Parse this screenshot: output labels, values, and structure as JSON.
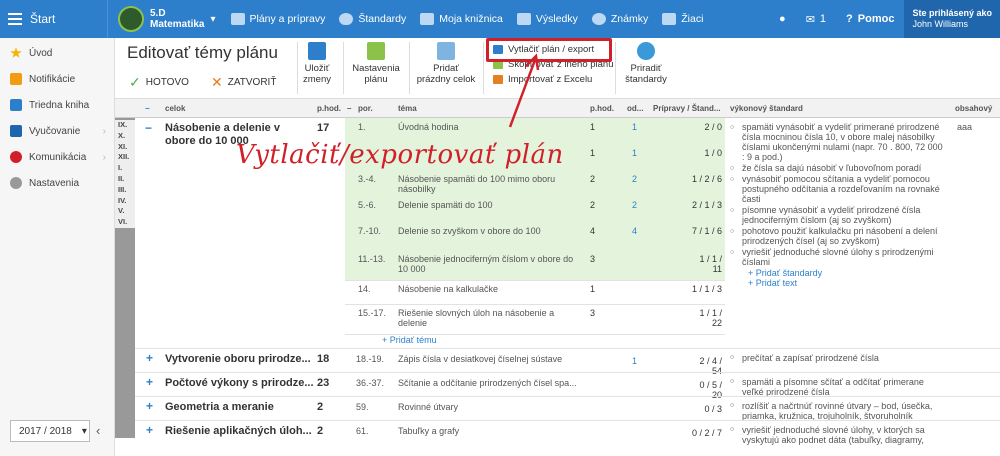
{
  "topbar": {
    "start": "Štart",
    "class_name": "5.D",
    "subject": "Matematika",
    "nav": [
      "Plány a prípravy",
      "Štandardy",
      "Moja knižnica",
      "Výsledky",
      "Známky",
      "Žiaci"
    ],
    "messages_count": "1",
    "help": "Pomoc",
    "login_label": "Ste prihlásený ako",
    "user": "John Williams"
  },
  "sidebar": {
    "items": [
      "Úvod",
      "Notifikácie",
      "Triedna kniha",
      "Vyučovanie",
      "Komunikácia",
      "Nastavenia"
    ],
    "year": "2017 / 2018"
  },
  "header": {
    "title": "Editovať témy plánu",
    "done": "HOTOVO",
    "close": "ZATVORIŤ",
    "save": [
      "Uložiť",
      "zmeny"
    ],
    "settings": [
      "Nastavenia",
      "plánu"
    ],
    "add_empty": [
      "Pridať",
      "prázdny celok"
    ],
    "print": "Vytlačiť plán / export",
    "copy": "Skopírovať z iného plánu",
    "import": "Importovať z Excelu",
    "assign": [
      "Priradiť",
      "štandardy"
    ]
  },
  "columns": {
    "celok": "celok",
    "phod": "p.hod.",
    "por": "por.",
    "tema": "téma",
    "phod2": "p.hod.",
    "od": "od...",
    "pripravy": "Prípravy / Štand...",
    "vykonovy": "výkonový štandard",
    "obsahovy": "obsahový"
  },
  "grades": [
    "IX.",
    "X.",
    "XI.",
    "XII.",
    "I.",
    "II.",
    "III.",
    "IV.",
    "V.",
    "VI."
  ],
  "main_celok": {
    "name": "Násobenie a delenie v obore do 10 000",
    "hours": "17"
  },
  "topics": [
    {
      "por": "1.",
      "tema": "Úvodná hodina",
      "h": "1",
      "od": "1",
      "stat": "2 / 0",
      "green": true
    },
    {
      "por": "",
      "tema": "",
      "h": "1",
      "od": "1",
      "stat": "1 / 0",
      "green": true
    },
    {
      "por": "3.-4.",
      "tema": "Násobenie spamäti do 100 mimo oboru násobilky",
      "h": "2",
      "od": "2",
      "stat": "1 / 2 / 6",
      "green": true
    },
    {
      "por": "5.-6.",
      "tema": "Delenie spamäti do 100",
      "h": "2",
      "od": "2",
      "stat": "2 / 1 / 3",
      "green": true
    },
    {
      "por": "7.-10.",
      "tema": "Delenie so zvyškom v obore do 100",
      "h": "4",
      "od": "4",
      "stat": "7 / 1 / 6",
      "green": true
    },
    {
      "por": "11.-13.",
      "tema": "Násobenie jednociferným číslom v obore do 10 000",
      "h": "3",
      "od": "",
      "stat": "1 / 1 / 11",
      "green": true
    },
    {
      "por": "14.",
      "tema": "Násobenie na kalkulačke",
      "h": "1",
      "od": "",
      "stat": "1 / 1 / 3",
      "green": false
    },
    {
      "por": "15.-17.",
      "tema": "Riešenie slovných úloh na násobenie a delenie",
      "h": "3",
      "od": "",
      "stat": "1 / 1 / 22",
      "green": false
    }
  ],
  "add_topic": "+ Pridať tému",
  "standards": [
    "spamäti vynásobiť a vydeliť primerané prirodzené čísla mocninou čísla 10, v obore malej násobilky číslami ukončenými nulami (napr. 70 . 800, 72 000 : 9 a pod.)",
    "že čísla sa dajú násobiť v ľubovoľnom poradí",
    "vynásobiť pomocou sčítania a vydeliť pomocou postupného odčítania a rozdeľovaním na rovnaké časti",
    "písomne vynásobiť a vydeliť prirodzené čísla jednociferným číslom (aj so zvyškom)",
    "pohotovo použiť kalkulačku pri násobení a delení prirodzených čísel (aj so zvyškom)",
    "vyriešiť jednoduché slovné úlohy s prirodzenými číslami"
  ],
  "obsahovy_value": "aaa",
  "add_standard": "+ Pridať štandardy",
  "add_text": "+ Pridať text",
  "other_celky": [
    {
      "name": "Vytvorenie oboru prirodze...",
      "hours": "18",
      "por": "18.-19.",
      "tema": "Zápis čísla v desiatkovej číselnej sústave",
      "od": "1",
      "stat": "2 / 4 / 54",
      "std": "prečítať a zapísať prirodzené čísla"
    },
    {
      "name": "Počtové výkony s prirodze...",
      "hours": "23",
      "por": "36.-37.",
      "tema": "Sčítanie a odčítanie prirodzených čísel spa...",
      "od": "",
      "stat": "0 / 5 / 20",
      "std": "spamäti a písomne sčítať a odčítať primerane veľké prirodzené čísla"
    },
    {
      "name": "Geometria a meranie",
      "hours": "2",
      "por": "59.",
      "tema": "Rovinné útvary",
      "od": "",
      "stat": "0 / 3",
      "std": "rozlíšiť a načrtnúť rovinné útvary – bod, úsečka, priamka, kružnica, trojuholník, štvoruholník"
    },
    {
      "name": "Riešenie aplikačných úloh...",
      "hours": "2",
      "por": "61.",
      "tema": "Tabuľky a grafy",
      "od": "",
      "stat": "0 / 2 / 7",
      "std": "vyriešiť jednoduché slovné úlohy, v ktorých sa vyskytujú ako podnet dáta (tabuľky, diagramy,"
    }
  ],
  "annotation": "Vytlačiť/exportovať plán",
  "colors": {
    "brand": "#2d7fcb",
    "highlight": "#d0212a",
    "green_row": "#e3f3dc"
  }
}
